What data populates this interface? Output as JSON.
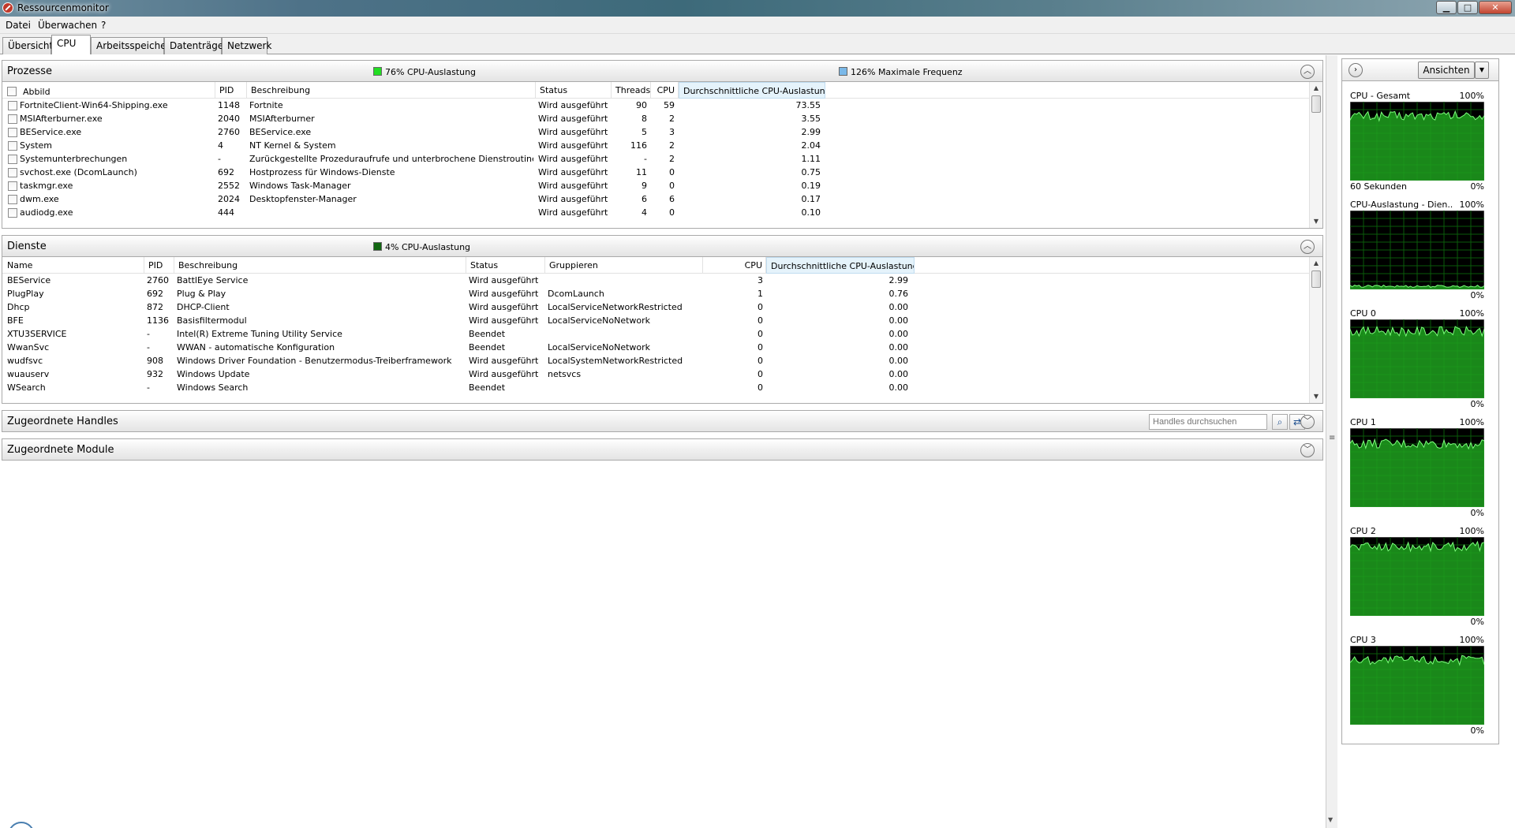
{
  "window": {
    "title": "Ressourcenmonitor"
  },
  "menu": {
    "file": "Datei",
    "monitor": "Überwachen",
    "help": "?"
  },
  "tabs": [
    "Übersicht",
    "CPU",
    "Arbeitsspeicher",
    "Datenträger",
    "Netzwerk"
  ],
  "processes": {
    "title": "Prozesse",
    "cpu_stat": "76% CPU-Auslastung",
    "freq_stat": "126% Maximale Frequenz",
    "cpu_stat_color": "#22dd22",
    "freq_stat_color": "#7ab8e8",
    "columns": [
      "Abbild",
      "PID",
      "Beschreibung",
      "Status",
      "Threads",
      "CPU",
      "Durchschnittliche CPU-Auslastung"
    ],
    "rows": [
      [
        "FortniteClient-Win64-Shipping.exe",
        "1148",
        "Fortnite",
        "Wird ausgeführt",
        "90",
        "59",
        "73.55"
      ],
      [
        "MSIAfterburner.exe",
        "2040",
        "MSIAfterburner",
        "Wird ausgeführt",
        "8",
        "2",
        "3.55"
      ],
      [
        "BEService.exe",
        "2760",
        "BEService.exe",
        "Wird ausgeführt",
        "5",
        "3",
        "2.99"
      ],
      [
        "System",
        "4",
        "NT Kernel & System",
        "Wird ausgeführt",
        "116",
        "2",
        "2.04"
      ],
      [
        "Systemunterbrechungen",
        "-",
        "Zurückgestellte Prozeduraufrufe und unterbrochene Dienstroutinen",
        "Wird ausgeführt",
        "-",
        "2",
        "1.11"
      ],
      [
        "svchost.exe (DcomLaunch)",
        "692",
        "Hostprozess für Windows-Dienste",
        "Wird ausgeführt",
        "11",
        "0",
        "0.75"
      ],
      [
        "taskmgr.exe",
        "2552",
        "Windows Task-Manager",
        "Wird ausgeführt",
        "9",
        "0",
        "0.19"
      ],
      [
        "dwm.exe",
        "2024",
        "Desktopfenster-Manager",
        "Wird ausgeführt",
        "6",
        "6",
        "0.17"
      ],
      [
        "audiodg.exe",
        "444",
        "",
        "Wird ausgeführt",
        "4",
        "0",
        "0.10"
      ]
    ]
  },
  "services": {
    "title": "Dienste",
    "cpu_stat": "4% CPU-Auslastung",
    "cpu_stat_color": "#116611",
    "columns": [
      "Name",
      "PID",
      "Beschreibung",
      "Status",
      "Gruppieren",
      "CPU",
      "Durchschnittliche CPU-Auslastung"
    ],
    "rows": [
      [
        "BEService",
        "2760",
        "BattlEye Service",
        "Wird ausgeführt",
        "",
        "3",
        "2.99"
      ],
      [
        "PlugPlay",
        "692",
        "Plug & Play",
        "Wird ausgeführt",
        "DcomLaunch",
        "1",
        "0.76"
      ],
      [
        "Dhcp",
        "872",
        "DHCP-Client",
        "Wird ausgeführt",
        "LocalServiceNetworkRestricted",
        "0",
        "0.00"
      ],
      [
        "BFE",
        "1136",
        "Basisfiltermodul",
        "Wird ausgeführt",
        "LocalServiceNoNetwork",
        "0",
        "0.00"
      ],
      [
        "XTU3SERVICE",
        "-",
        "Intel(R) Extreme Tuning Utility Service",
        "Beendet",
        "",
        "0",
        "0.00"
      ],
      [
        "WwanSvc",
        "-",
        "WWAN - automatische Konfiguration",
        "Beendet",
        "LocalServiceNoNetwork",
        "0",
        "0.00"
      ],
      [
        "wudfsvc",
        "908",
        "Windows Driver Foundation - Benutzermodus-Treiberframework",
        "Wird ausgeführt",
        "LocalSystemNetworkRestricted",
        "0",
        "0.00"
      ],
      [
        "wuauserv",
        "932",
        "Windows Update",
        "Wird ausgeführt",
        "netsvcs",
        "0",
        "0.00"
      ],
      [
        "WSearch",
        "-",
        "Windows Search",
        "Beendet",
        "",
        "0",
        "0.00"
      ]
    ]
  },
  "handles": {
    "title": "Zugeordnete Handles",
    "search_placeholder": "Handles durchsuchen"
  },
  "modules": {
    "title": "Zugeordnete Module"
  },
  "side_panel": {
    "views_label": "Ansichten",
    "graphs": [
      {
        "title": "CPU - Gesamt",
        "max": "100%",
        "foot_left": "60 Sekunden",
        "foot_right": "0%",
        "level": 0.82
      },
      {
        "title": "CPU-Auslastung - Dien...",
        "max": "100%",
        "foot_left": "",
        "foot_right": "0%",
        "level": 0.04
      },
      {
        "title": "CPU 0",
        "max": "100%",
        "foot_left": "",
        "foot_right": "0%",
        "level": 0.85
      },
      {
        "title": "CPU 1",
        "max": "100%",
        "foot_left": "",
        "foot_right": "0%",
        "level": 0.8
      },
      {
        "title": "CPU 2",
        "max": "100%",
        "foot_left": "",
        "foot_right": "0%",
        "level": 0.88
      },
      {
        "title": "CPU 3",
        "max": "100%",
        "foot_left": "",
        "foot_right": "0%",
        "level": 0.82
      }
    ]
  }
}
